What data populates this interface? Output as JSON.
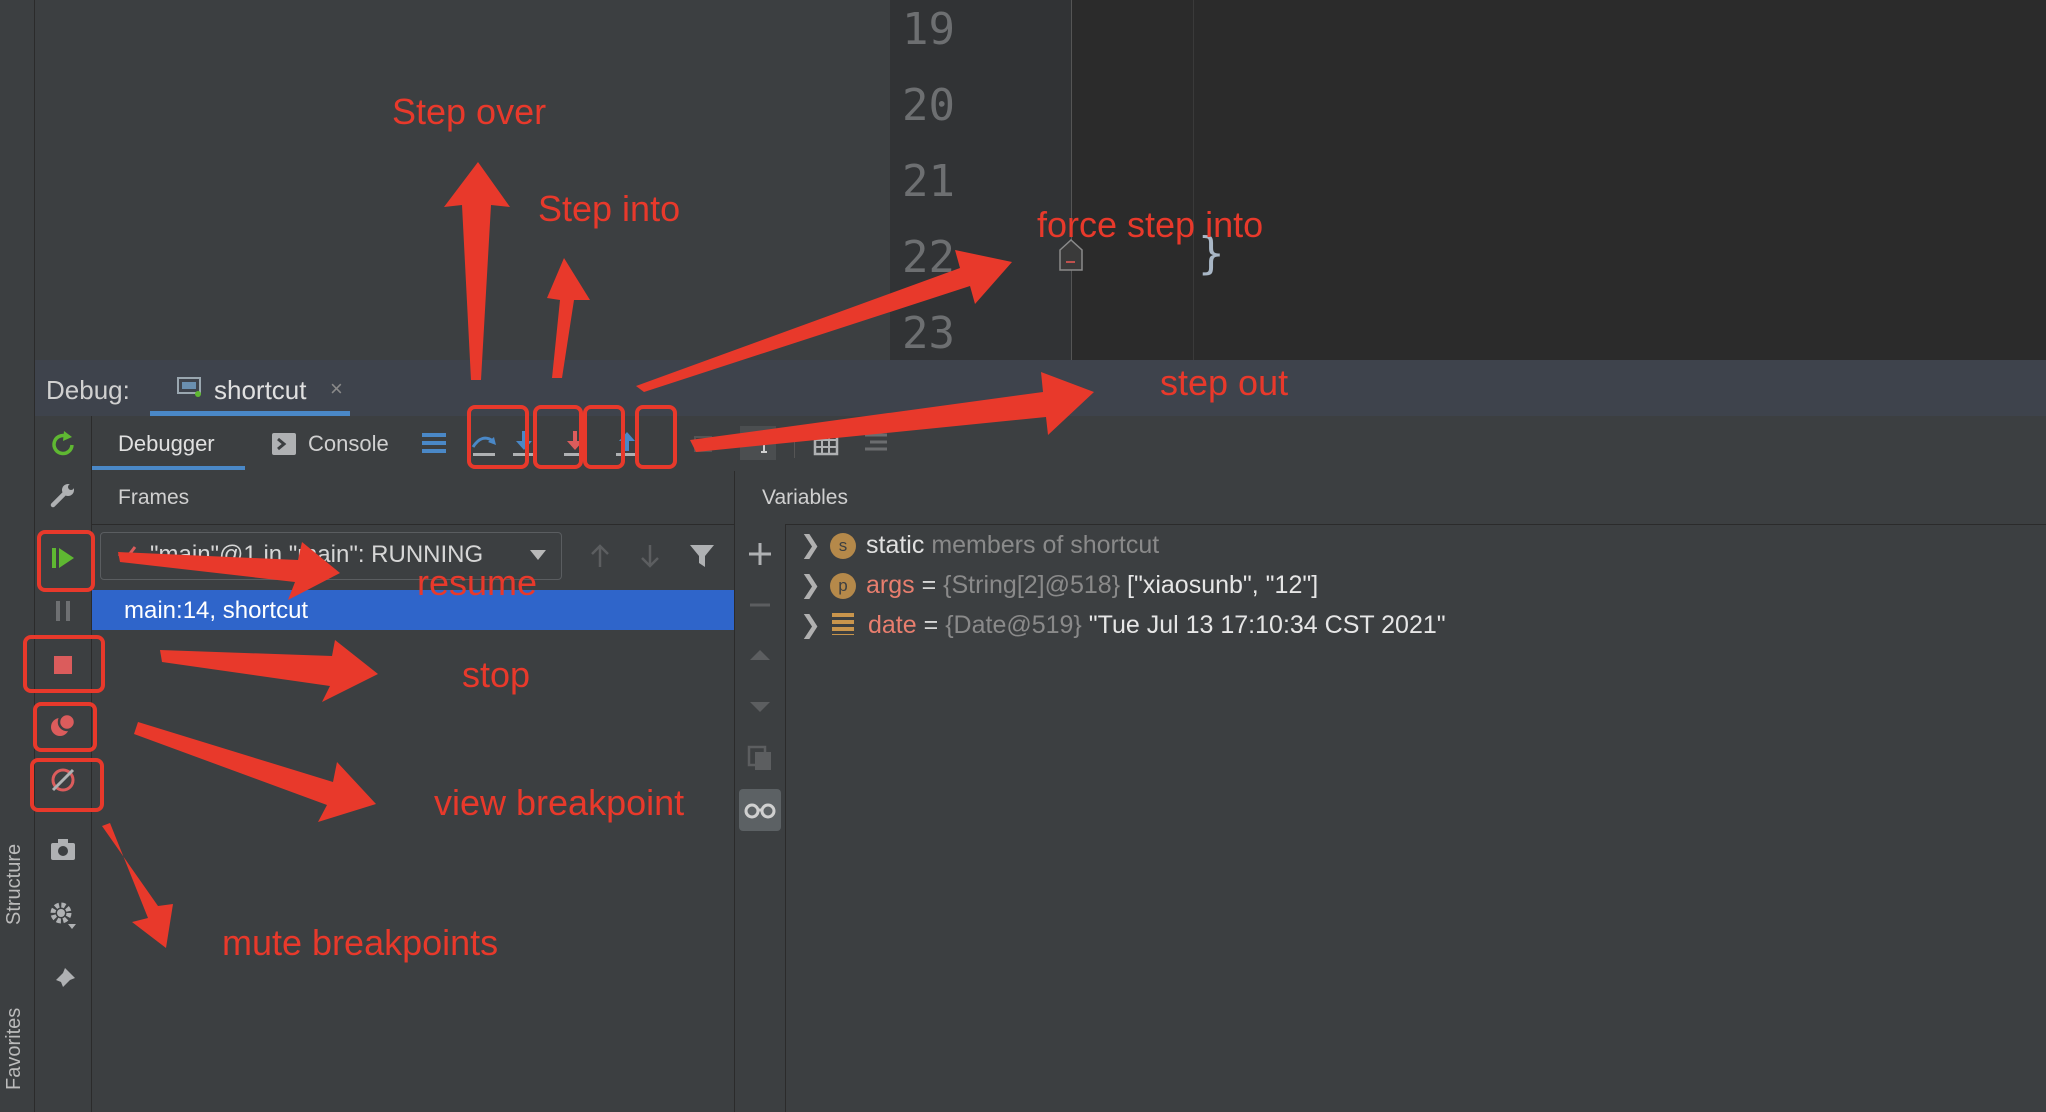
{
  "sidebar": {
    "structure_label": "Structure",
    "favorites_label": "Favorites"
  },
  "editor": {
    "line_numbers": [
      "19",
      "20",
      "21",
      "22",
      "23"
    ],
    "code_brace": "}"
  },
  "debug": {
    "label": "Debug:",
    "session_tab": "shortcut",
    "close_symbol": "×"
  },
  "tabs": {
    "debugger": "Debugger",
    "console": "Console"
  },
  "frames": {
    "title": "Frames",
    "thread": "\"main\"@1 in \"main\": RUNNING",
    "selected_frame": "main:14, shortcut"
  },
  "variables": {
    "title": "Variables",
    "items": [
      {
        "kind": "static",
        "badge": "s",
        "keyword": "static",
        "rest": "members of shortcut"
      },
      {
        "kind": "param",
        "badge": "p",
        "name": "args",
        "eq": "=",
        "type": "{String[2]@518}",
        "value": "[\"xiaosunb\", \"12\"]"
      },
      {
        "kind": "field",
        "name": "date",
        "eq": "=",
        "type": "{Date@519}",
        "value": "\"Tue Jul 13 17:10:34 CST 2021\""
      }
    ]
  },
  "annotations": {
    "step_over": "Step over",
    "step_into": "Step into",
    "force_step_into": "force step into",
    "step_out": "step out",
    "resume": "resume",
    "stop": "stop",
    "view_breakpoint": "view breakpoint",
    "mute_breakpoints": "mute breakpoints"
  },
  "colors": {
    "annotation": "#e8392b",
    "selection": "#2f65ca",
    "tab_accent": "#4a88c7"
  }
}
